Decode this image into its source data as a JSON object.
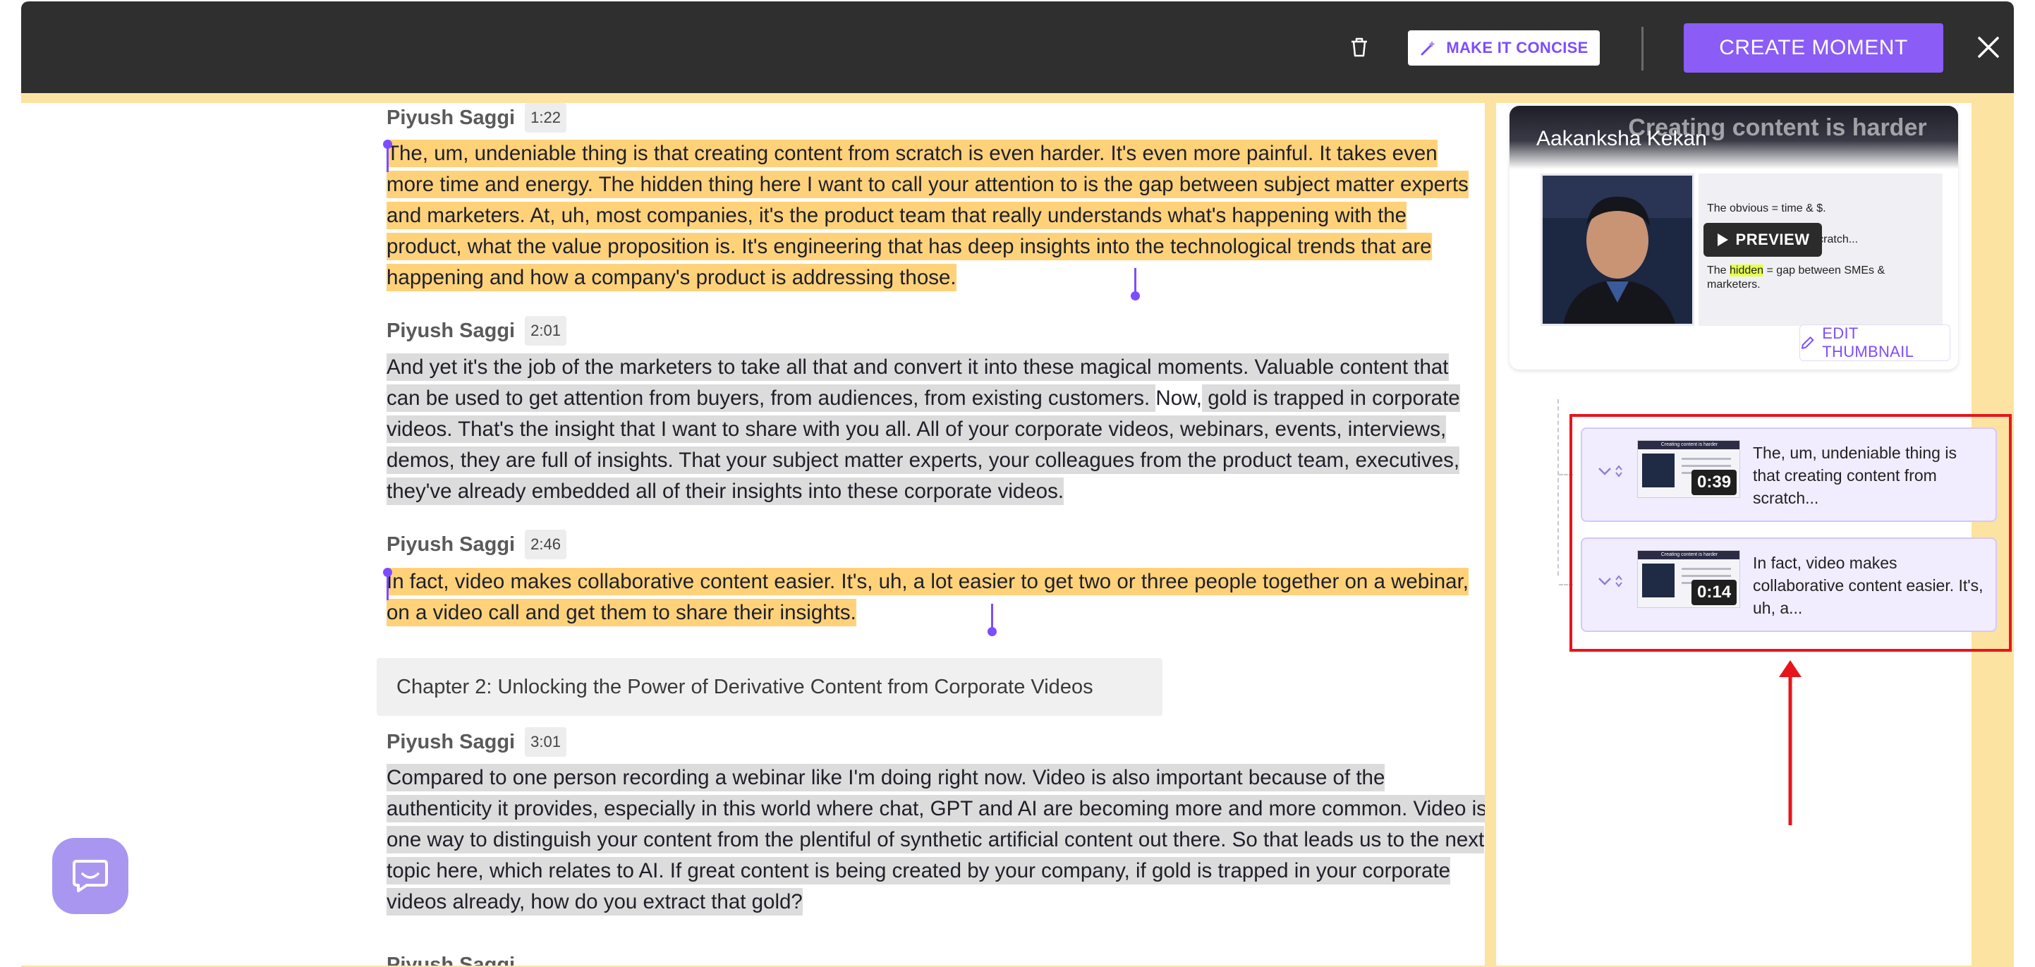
{
  "toolbar": {
    "concise_label": "MAKE IT CONCISE",
    "create_label": "CREATE MOMENT",
    "icons": {
      "trash": "trash-icon",
      "wand": "magic-wand-icon",
      "close": "close-icon"
    }
  },
  "transcript": {
    "blocks": [
      {
        "speaker": "Piyush Saggi",
        "time": "1:22",
        "text": "The, um, undeniable thing is that creating content from scratch is even harder. It's even more painful. It takes even more time and energy. The hidden thing here I want to call your attention to is the gap between subject matter experts and marketers. At, uh, most companies, it's the product team that really understands what's happening with the product, what the value proposition is. It's engineering that has deep insights into the technological trends that are happening and how a company's product is addressing those."
      },
      {
        "speaker": "Piyush Saggi",
        "time": "2:01",
        "text_a": "And yet it's the job of the marketers to take all that and convert it into these magical moments. Valuable content that can be used to get attention from buyers, from audiences, from existing customers. ",
        "text_b": "Now,",
        "text_c": " gold is trapped in corporate videos. That's the insight that I want to share with you all. All of your corporate videos, webinars, events, interviews, demos, they are full of insights. That your subject matter experts, your colleagues from the product team, executives, they've already embedded all of their insights into these corporate videos."
      },
      {
        "speaker": "Piyush Saggi",
        "time": "2:46",
        "text": "In fact, video makes collaborative content easier. It's, uh, a lot easier to get two or three people together on a webinar, on a video call and get them to share their insights."
      },
      {
        "speaker": "Piyush Saggi",
        "time": "3:01",
        "text": "Compared to one person recording a webinar like I'm doing right now. Video is also important because of the authenticity it provides, especially in this world where chat, GPT and AI are becoming more and more common. Video is one way to distinguish your content from the plentiful of synthetic artificial content out there. So that leads us to the next topic here, which relates to AI. If great content is being created by your company, if gold is trapped in your corporate videos already, how do you extract that gold?"
      }
    ],
    "chapter": "Chapter 2: Unlocking the Power of Derivative Content from Corporate Videos",
    "next_speaker": "Piyush Saggi"
  },
  "preview": {
    "title_ghost": "Creating content is harder",
    "presenter": "Aakanksha Kekan",
    "slide_line1": "The obvious = time & $.",
    "slide_line2": "= starting from scratch...",
    "slide_line3_pre": "The ",
    "slide_line3_hl": "hidden",
    "slide_line3_post": " = gap between SMEs & marketers.",
    "preview_label": "PREVIEW",
    "edit_thumb_label": "EDIT THUMBNAIL",
    "icons": {
      "play": "play-icon",
      "pencil": "pencil-icon"
    }
  },
  "moments": [
    {
      "duration": "0:39",
      "text": "The, um, undeniable thing is that creating content from scratch...",
      "thumb_title": "Creating content is harder"
    },
    {
      "duration": "0:14",
      "text": "In fact, video makes collaborative content easier. It's, uh, a...",
      "thumb_title": "Creating content is harder"
    }
  ],
  "annotation": {
    "box_color": "#e8141c"
  },
  "colors": {
    "accent": "#8b5cf6",
    "highlight_yellow": "#ffd27a",
    "highlight_gray": "#dcdcdc",
    "frame": "#fde3a1"
  }
}
